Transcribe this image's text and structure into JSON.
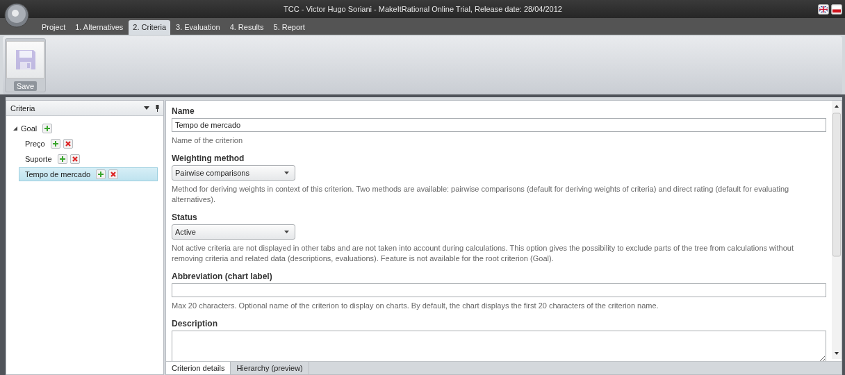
{
  "window": {
    "title": "TCC - Victor Hugo Soriani - MakeItRational Online Trial, Release date: 28/04/2012"
  },
  "menu_tabs": [
    {
      "label": "Project",
      "selected": false
    },
    {
      "label": "1. Alternatives",
      "selected": false
    },
    {
      "label": "2. Criteria",
      "selected": true
    },
    {
      "label": "3. Evaluation",
      "selected": false
    },
    {
      "label": "4. Results",
      "selected": false
    },
    {
      "label": "5. Report",
      "selected": false
    }
  ],
  "ribbon": {
    "buttons": [
      {
        "label": "Save",
        "disabled": true
      }
    ]
  },
  "criteria_panel": {
    "title": "Criteria",
    "tree": [
      {
        "label": "Goal",
        "expanded": true,
        "selected": false,
        "deletable": false,
        "children": [
          {
            "label": "Preço",
            "selected": false,
            "deletable": true
          },
          {
            "label": "Suporte",
            "selected": false,
            "deletable": true
          },
          {
            "label": "Tempo de mercado",
            "selected": true,
            "deletable": true
          }
        ]
      }
    ]
  },
  "form": {
    "fields": [
      {
        "kind": "text",
        "label": "Name",
        "value": "Tempo de mercado",
        "help": "Name of the criterion"
      },
      {
        "kind": "select",
        "label": "Weighting method",
        "value": "Pairwise comparisons",
        "help": "Method for deriving weights in context of this criterion. Two methods are available: pairwise comparisons (default for deriving weights of criteria) and direct rating (default for evaluating alternatives)."
      },
      {
        "kind": "select",
        "label": "Status",
        "value": "Active",
        "help": "Not active criteria are not displayed in other tabs and are not taken into account during calculations. This option gives the possibility to exclude parts of the tree from calculations without removing criteria and related data (descriptions, evaluations). Feature is not available for the root criterion (Goal)."
      },
      {
        "kind": "text",
        "label": "Abbreviation (chart label)",
        "help": "Max 20 characters. Optional name of the criterion to display on charts. By default, the chart displays the first 20 characters of the criterion name."
      },
      {
        "kind": "textarea",
        "label": "Description"
      }
    ]
  },
  "bottom_tabs": [
    {
      "label": "Criterion details",
      "selected": true
    },
    {
      "label": "Hierarchy (preview)",
      "selected": false
    }
  ]
}
